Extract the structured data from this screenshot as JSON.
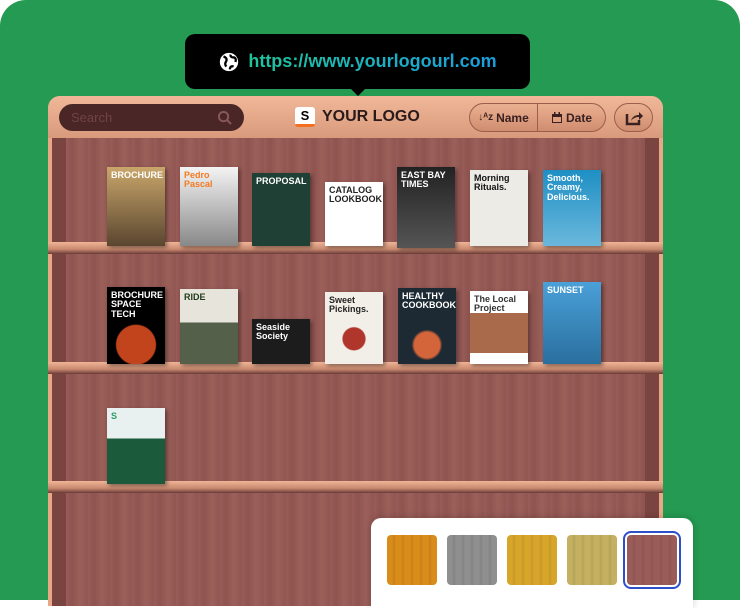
{
  "tooltip": {
    "url": "https://www.yourlogourl.com",
    "icon": "globe-icon"
  },
  "header": {
    "search_placeholder": "Search",
    "logo_letter": "S",
    "logo_text": "YOUR LOGO",
    "sort_name": "Name",
    "sort_date": "Date"
  },
  "books": [
    {
      "title": "BROCHURE",
      "bg": "linear-gradient(#c9a66a,#5a4630)",
      "color": "#fff"
    },
    {
      "title": "Pedro Pascal",
      "bg": "linear-gradient(#f4f4f4,#888)",
      "color": "#f47a20"
    },
    {
      "title": "PROPOSAL",
      "bg": "#1f4034",
      "color": "#fff"
    },
    {
      "title": "CATALOG LOOKBOOK",
      "bg": "#fff",
      "color": "#222"
    },
    {
      "title": "EAST BAY TIMES",
      "bg": "linear-gradient(#222,#555)",
      "color": "#fff"
    },
    {
      "title": "Morning Rituals.",
      "bg": "#ecebe6",
      "color": "#111"
    },
    {
      "title": "Smooth, Creamy, Delicious.",
      "bg": "linear-gradient(#1e8fc4,#6ab8dc)",
      "color": "#fff"
    },
    {
      "title": "BROCHURE SPACE TECH",
      "bg": "radial-gradient(circle at 50% 75%,#c2441c 30%,#000 32%)",
      "color": "#fff"
    },
    {
      "title": "RIDE",
      "bg": "linear-gradient(#e7e4dc 45%,#55604a 45%)",
      "color": "#1f3a1a"
    },
    {
      "title": "Seaside Society",
      "bg": "#1c1c1c",
      "color": "#fff"
    },
    {
      "title": "Sweet Pickings.",
      "bg": "radial-gradient(circle at 50% 65%,#b0352a 20%,#f2efe8 22%)",
      "color": "#222"
    },
    {
      "title": "HEALTHY COOKBOOK",
      "bg": "radial-gradient(circle at 50% 75%,#d4643a 20%,#1d2a33 24%)",
      "color": "#fff"
    },
    {
      "title": "The Local Project",
      "bg": "linear-gradient(#fff 30%,#a86a4a 30%,#a86a4a 85%,#fff 85%)",
      "color": "#333"
    },
    {
      "title": "SUNSET",
      "bg": "linear-gradient(#4aa0d8,#2a6f9e)",
      "color": "#fff"
    },
    {
      "title": "S",
      "bg": "linear-gradient(#e8f0f0 40%,#1c5a3c 40%)",
      "color": "#2e9a6a"
    }
  ],
  "swatches": [
    {
      "name": "orange-wood",
      "color": "#d98c1a",
      "selected": false
    },
    {
      "name": "gray-wood",
      "color": "#8f8f8f",
      "selected": false
    },
    {
      "name": "gold-wood",
      "color": "#d6a52a",
      "selected": false
    },
    {
      "name": "olive-wood",
      "color": "#c4b060",
      "selected": false
    },
    {
      "name": "cherry-wood",
      "color": "#9a5c58",
      "selected": true
    }
  ]
}
